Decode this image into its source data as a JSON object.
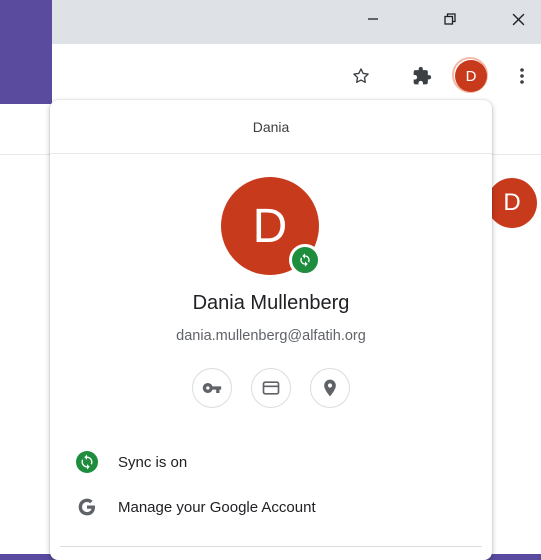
{
  "window": {
    "minimize_icon": "minimize-icon",
    "restore_icon": "restore-icon",
    "close_icon": "close-icon"
  },
  "toolbar": {
    "bookmark_icon": "star-icon",
    "extensions_icon": "puzzle-icon",
    "profile_initial": "D",
    "menu_icon": "more-vert-icon"
  },
  "background": {
    "page_avatar_initial": "D"
  },
  "profile_menu": {
    "header_title": "Dania",
    "avatar_initial": "D",
    "name": "Dania Mullenberg",
    "email": "dania.mullenberg@alfatih.org",
    "quick_actions": [
      {
        "icon": "key-icon"
      },
      {
        "icon": "credit-card-icon"
      },
      {
        "icon": "location-pin-icon"
      }
    ],
    "items": [
      {
        "label": "Sync is on",
        "icon": "sync-icon"
      },
      {
        "label": "Manage your Google Account",
        "icon": "google-icon"
      }
    ]
  },
  "colors": {
    "avatar": "#c83a1c",
    "sync_green": "#1e8e3e",
    "desktop_purple": "#5b4b9e"
  }
}
